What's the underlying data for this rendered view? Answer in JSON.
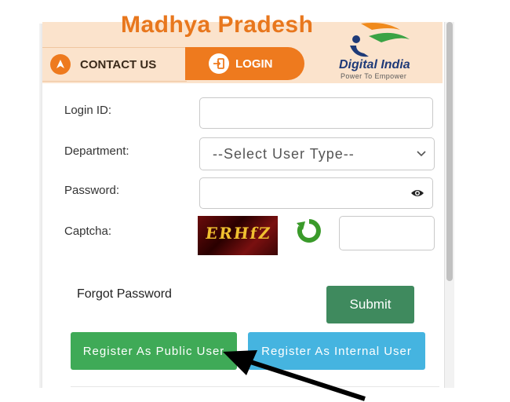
{
  "header": {
    "title": "Madhya Pradesh",
    "logo": {
      "name": "Digital India",
      "tagline": "Power To Empower"
    }
  },
  "nav": {
    "contact_label": "CONTACT US",
    "login_label": "LOGIN"
  },
  "form": {
    "login_id_label": "Login ID:",
    "login_id_value": "",
    "department_label": "Department:",
    "department_selected": "--Select User Type--",
    "password_label": "Password:",
    "password_value": "",
    "captcha_label": "Captcha:",
    "captcha_text": "ERHfZ",
    "captcha_input_value": "",
    "forgot_label": "Forgot Password",
    "submit_label": "Submit"
  },
  "buttons": {
    "register_public": "Register As Public User",
    "register_internal": "Register As Internal User"
  },
  "colors": {
    "header_bg": "#fbe3cc",
    "accent_orange": "#ee7a1e",
    "submit_green": "#3f8a5e",
    "public_green": "#3faa57",
    "internal_blue": "#45b4e0",
    "captcha_bg": "#6b0b0b"
  },
  "icons": {
    "contact": "compass-arrow-icon",
    "login": "login-door-icon",
    "eye": "eye-icon",
    "refresh": "refresh-icon",
    "dropdown": "chevron-down-icon"
  }
}
